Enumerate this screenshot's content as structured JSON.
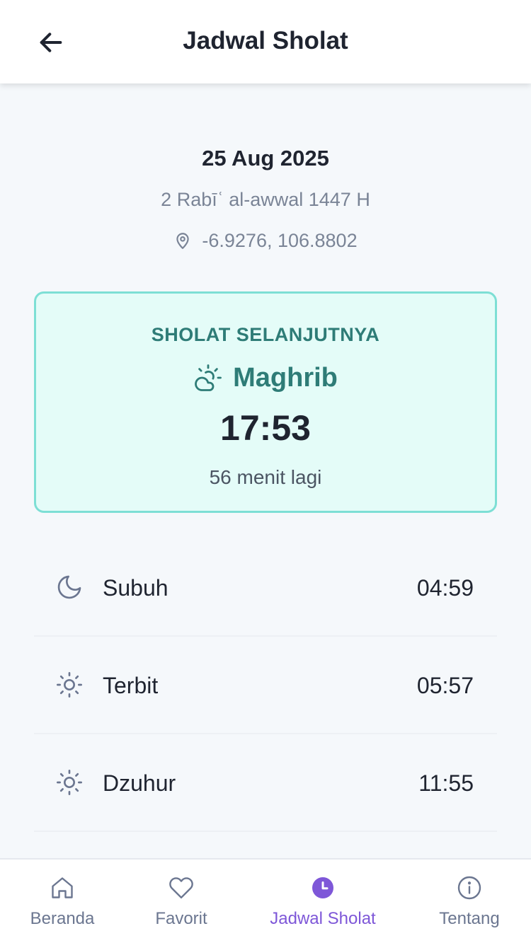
{
  "header": {
    "title": "Jadwal Sholat",
    "back_icon": "arrow-left-icon"
  },
  "date": {
    "gregorian": "25 Aug 2025",
    "hijri": "2 Rabīʿ al-awwal 1447 H",
    "location": "-6.9276, 106.8802",
    "location_icon": "map-pin-icon"
  },
  "next_prayer": {
    "label": "SHOLAT SELANJUTNYA",
    "name": "Maghrib",
    "icon": "cloud-sun-icon",
    "time": "17:53",
    "countdown": "56 menit lagi"
  },
  "prayers": [
    {
      "name": "Subuh",
      "time": "04:59",
      "icon": "moon-icon"
    },
    {
      "name": "Terbit",
      "time": "05:57",
      "icon": "sun-icon"
    },
    {
      "name": "Dzuhur",
      "time": "11:55",
      "icon": "sun-icon"
    }
  ],
  "nav": {
    "items": [
      {
        "label": "Beranda",
        "icon": "home-icon",
        "active": false
      },
      {
        "label": "Favorit",
        "icon": "heart-icon",
        "active": false
      },
      {
        "label": "Jadwal Sholat",
        "icon": "clock-icon",
        "active": true
      },
      {
        "label": "Tentang",
        "icon": "info-icon",
        "active": false
      }
    ]
  },
  "colors": {
    "accent": "#2e7c77",
    "card_bg": "#e4fcf8",
    "card_border": "#7ddfd5",
    "nav_active": "#7e57d8",
    "muted": "#7a8496"
  }
}
